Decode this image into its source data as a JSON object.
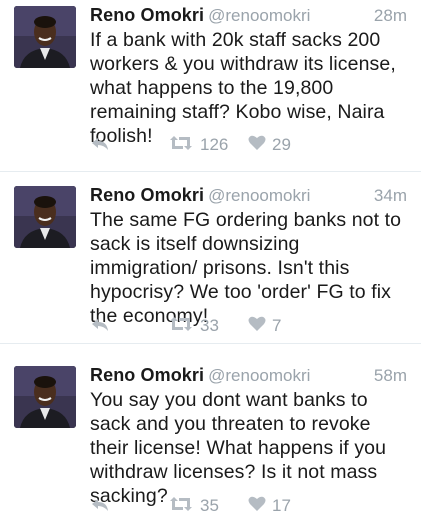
{
  "tweets": [
    {
      "name": "Reno Omokri",
      "handle": "@renoomokri",
      "time": "28m",
      "text": "If a bank with 20k staff sacks 200 workers & you withdraw its license, what happens to the 19,800 remaining staff? Kobo wise, Naira foolish!",
      "retweets": "126",
      "likes": "29"
    },
    {
      "name": "Reno Omokri",
      "handle": "@renoomokri",
      "time": "34m",
      "text": "The same FG ordering banks not to sack is itself downsizing immigration/ prisons. Isn't this hypocrisy? We too 'order' FG to fix the economy!",
      "retweets": "33",
      "likes": "7"
    },
    {
      "name": "Reno Omokri",
      "handle": "@renoomokri",
      "time": "58m",
      "text": "You say you dont want banks to sack and you threaten to revoke their license! What happens if you withdraw licenses? Is it not mass sacking?",
      "retweets": "35",
      "likes": "17"
    }
  ],
  "icons": {
    "reply": "reply-icon",
    "retweet": "retweet-icon",
    "like": "heart-icon"
  },
  "colors": {
    "text": "#1a1a1a",
    "muted": "#9aa3ab",
    "icon": "#b5bcc3",
    "divider": "#e6ecf0"
  }
}
